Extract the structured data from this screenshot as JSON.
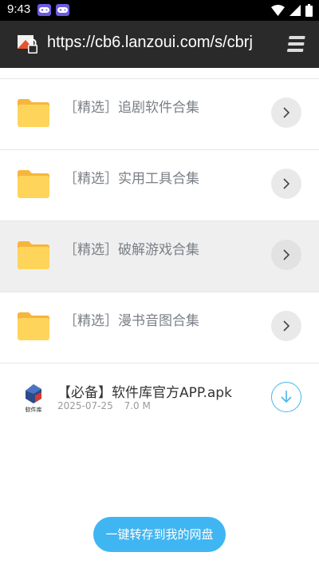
{
  "status_bar": {
    "time": "9:43",
    "icons": [
      "game-controller-icon",
      "game-controller-icon",
      "wifi-icon",
      "cell-signal-icon",
      "battery-icon"
    ]
  },
  "browser": {
    "url": "https://cb6.lanzoui.com/s/cbrj"
  },
  "folders": [
    {
      "label": "［精选］追剧软件合集",
      "icon": "folder-icon"
    },
    {
      "label": "［精选］实用工具合集",
      "icon": "folder-icon"
    },
    {
      "label": "［精选］破解游戏合集",
      "icon": "folder-icon",
      "highlighted": true
    },
    {
      "label": "［精选］漫书音图合集",
      "icon": "folder-icon"
    }
  ],
  "file": {
    "name": "【必备】软件库官方APP.apk",
    "date": "2025-07-25",
    "size": "7.0 M",
    "logo_text": "软件库"
  },
  "save_button": {
    "label": "一键转存到我的网盘"
  },
  "colors": {
    "accent": "#3fb6f2",
    "folder": "#ffd45a",
    "toolbar": "#2a2a2a"
  }
}
